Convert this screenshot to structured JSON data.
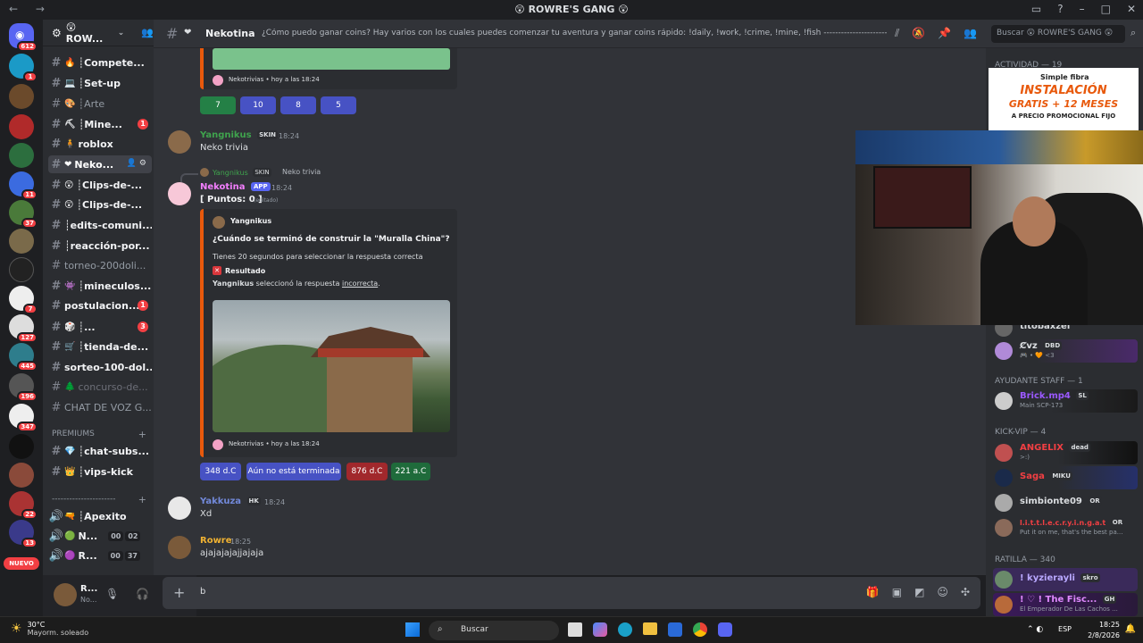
{
  "window": {
    "title": "😲 ROWRE'S GANG 😲",
    "nav": "← →"
  },
  "guild": {
    "name": "😲 ROW...",
    "new_label": "NUEVO"
  },
  "rail_badges": [
    "612",
    "1",
    "",
    "",
    "",
    "",
    "",
    "11",
    "37",
    "",
    "",
    "",
    "7",
    "127",
    "445",
    "196",
    "347",
    "",
    "",
    "22",
    "13"
  ],
  "channels": [
    {
      "emoji": "🔥",
      "label": "┊Compete...",
      "bold": true
    },
    {
      "emoji": "💻",
      "label": "┊Set-up",
      "bold": true
    },
    {
      "emoji": "🎨",
      "label": "┊Arte",
      "bold": false
    },
    {
      "emoji": "⛏",
      "label": "┊Mine...",
      "bold": true,
      "badge": "1"
    },
    {
      "emoji": "🧍",
      "label": "roblox",
      "bold": true
    },
    {
      "emoji": "❤",
      "label": "Neko...",
      "selected": true
    },
    {
      "emoji": "😲",
      "label": "┊Clips-de-...",
      "bold": true
    },
    {
      "emoji": "😲",
      "label": "┊Clips-de-...",
      "bold": true
    },
    {
      "emoji": "",
      "label": "┊edits-comuni...",
      "bold": true
    },
    {
      "emoji": "",
      "label": "┊reacción-por...",
      "bold": true
    },
    {
      "emoji": "",
      "label": "torneo-200doli...",
      "bold": false
    },
    {
      "emoji": "👾",
      "label": "┊mineculos...",
      "bold": true
    },
    {
      "emoji": "",
      "label": "postulacion...",
      "bold": true,
      "badge": "1"
    },
    {
      "emoji": "🎲",
      "label": "┊...",
      "bold": true,
      "badge": "3"
    },
    {
      "emoji": "🛒",
      "label": "┊tienda-de...",
      "bold": true
    },
    {
      "emoji": "",
      "label": "sorteo-100-dol...",
      "bold": true
    },
    {
      "emoji": "🌲",
      "label": "concurso-de...",
      "muted": true
    },
    {
      "emoji": "",
      "label": "CHAT DE VOZ G...",
      "bold": false
    }
  ],
  "category_premiums": "PREMIUMS",
  "premium_channels": [
    {
      "emoji": "💎",
      "label": "┊chat-subs..."
    },
    {
      "emoji": "👑",
      "label": "┊vips-kick"
    }
  ],
  "category_divider": "----------------------",
  "voice_channels": [
    {
      "emoji": "🔫",
      "label": "┊Apexito"
    },
    {
      "emoji": "🟢",
      "label": "N...",
      "counts": [
        "00",
        "02"
      ]
    },
    {
      "emoji": "🟣",
      "label": "R...",
      "counts": [
        "00",
        "37"
      ]
    }
  ],
  "user_panel": {
    "name": "R...",
    "status": "No..."
  },
  "header": {
    "channel": "Nekotina",
    "topic": "¿Cómo puedo ganar coins? Hay varios con los cuales puedes comenzar tu aventura y ganar coins rápido: !daily, !work, !crime, !mine, !fish ---------------------------------------------...",
    "search_placeholder": "Buscar 😲 ROWRE'S GANG 😲"
  },
  "messages": {
    "prev_embed_footer": "Nekotrivias • hoy a las 18:24",
    "prev_buttons": [
      "7",
      "10",
      "8",
      "5"
    ],
    "m1": {
      "author": "Yangnikus",
      "tag": "SKIN",
      "time": "18:24",
      "text": "Neko trivia",
      "author_color": "#3fa34d"
    },
    "reply": {
      "author": "Yangnikus",
      "tag": "SKIN",
      "text": "Neko trivia"
    },
    "m2": {
      "author": "Nekotina",
      "app": "APP",
      "time": "18:24",
      "text": "[ Puntos: 0 ]",
      "edited": "(editado)",
      "author_color": "#f47fff"
    },
    "embed": {
      "author": "Yangnikus",
      "question": "¿Cuándo se terminó de construir la \"Muralla China\"?",
      "instructions": "Tienes 20 segundos para seleccionar la respuesta correcta",
      "result_title": "Resultado",
      "result_user": "Yangnikus",
      "result_text1": " seleccionó la respuesta ",
      "result_link": "incorrecta",
      "result_end": ".",
      "footer": "Nekotrivias • hoy a las 18:24"
    },
    "answer_buttons": [
      "348 d.C",
      "Aún no está terminada",
      "876 d.C",
      "221 a.C"
    ],
    "m3": {
      "author": "Yakkuza",
      "tag": "HK",
      "time": "18:24",
      "text": "Xd",
      "author_color": "#7289da"
    },
    "m4": {
      "author": "Rowre",
      "time": "18:25",
      "text": "ajajajajajjajaja",
      "author_color": "#f0b232"
    }
  },
  "composer": {
    "value": "b"
  },
  "members": {
    "activity_header": "Actividad — 19",
    "m_a": {
      "name": "titobaxzel"
    },
    "m_b": {
      "name": "Ȼvz",
      "tag": "DBD",
      "status": "🎮 • 🧡 <3"
    },
    "group_ayudante": "AYUDANTE STAFF — 1",
    "m_c": {
      "name": "Brick.mp4",
      "tag": "SL",
      "status": "Main SCP-173"
    },
    "group_kick": "KICK-VIP — 4",
    "m_d": {
      "name": "ANGELIX",
      "tag": "dead",
      "status": ">:)"
    },
    "m_e": {
      "name": "Saga",
      "tag": "MIKU"
    },
    "m_f": {
      "name": "simbionte09",
      "tag": "OR"
    },
    "m_g": {
      "name": "l.i.t.t.l.e.c.r.y.i.n.g.a.t.l...",
      "tag": "OR",
      "status": "Put it on me, that's the best pa..."
    },
    "group_ratilla": "Ratilla — 340",
    "m_h": {
      "name": "! kyzierayli",
      "tag": "skro"
    },
    "m_i": {
      "name": "! ♡ ! The Fisc...",
      "tag": "GH",
      "status": "El Emperador De Las Cachos ..."
    }
  },
  "ad": {
    "brand": "Simple fibra",
    "line1": "INSTALACIÓN",
    "line2": "GRATIS + 12 MESES",
    "line3": "A PRECIO PROMOCIONAL FIJO"
  },
  "taskbar": {
    "temp": "30°C",
    "weather": "Mayorm. soleado",
    "search": "Buscar",
    "lang": "ESP",
    "time": "18:25",
    "date": "2/8/2026"
  }
}
